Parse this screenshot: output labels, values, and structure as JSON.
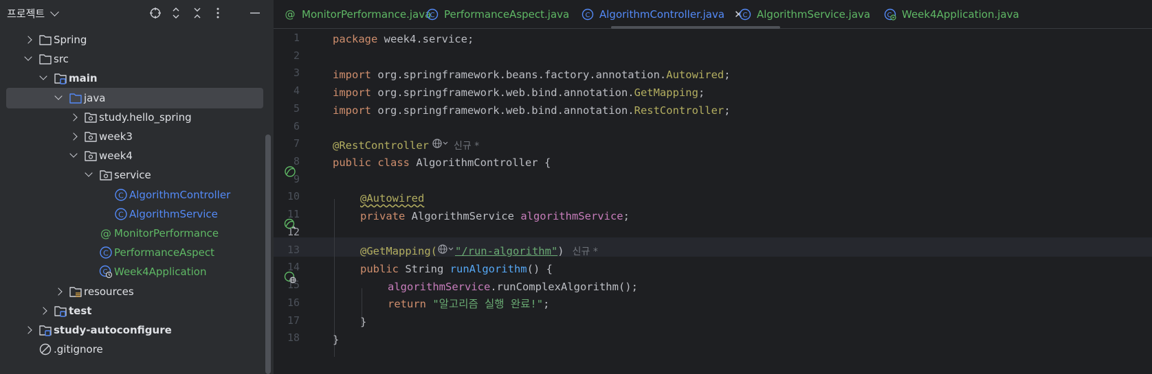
{
  "project_panel": {
    "title": "프로젝트",
    "tree": [
      {
        "label": "Spring",
        "icon": "folder-icon",
        "arrow": "right",
        "level": 1,
        "style": "normal"
      },
      {
        "label": "src",
        "icon": "folder-icon",
        "arrow": "down",
        "level": 1,
        "style": "normal"
      },
      {
        "label": "main",
        "icon": "module-folder-icon",
        "arrow": "down",
        "level": 2,
        "style": "bold"
      },
      {
        "label": "java",
        "icon": "source-folder-icon",
        "arrow": "down",
        "level": 3,
        "style": "normal",
        "selected": true
      },
      {
        "label": "study.hello_spring",
        "icon": "package-icon",
        "arrow": "right",
        "level": 4,
        "style": "normal"
      },
      {
        "label": "week3",
        "icon": "package-icon",
        "arrow": "right",
        "level": 4,
        "style": "normal"
      },
      {
        "label": "week4",
        "icon": "package-icon",
        "arrow": "down",
        "level": 4,
        "style": "normal"
      },
      {
        "label": "service",
        "icon": "package-icon",
        "arrow": "down",
        "level": 5,
        "style": "normal"
      },
      {
        "label": "AlgorithmController",
        "icon": "class-icon",
        "arrow": "none",
        "level": 6,
        "style": "blue"
      },
      {
        "label": "AlgorithmService",
        "icon": "class-icon",
        "arrow": "none",
        "level": 6,
        "style": "blue"
      },
      {
        "label": "MonitorPerformance",
        "icon": "annotation-icon",
        "arrow": "none",
        "level": 5,
        "style": "green"
      },
      {
        "label": "PerformanceAspect",
        "icon": "class-icon",
        "arrow": "none",
        "level": 5,
        "style": "green"
      },
      {
        "label": "Week4Application",
        "icon": "spring-class-icon",
        "arrow": "none",
        "level": 5,
        "style": "green"
      },
      {
        "label": "resources",
        "icon": "resources-folder-icon",
        "arrow": "right",
        "level": 3,
        "style": "normal"
      },
      {
        "label": "test",
        "icon": "module-folder-icon",
        "arrow": "right",
        "level": 2,
        "style": "bold"
      },
      {
        "label": "study-autoconfigure",
        "icon": "module-folder-icon",
        "arrow": "right",
        "level": 1,
        "style": "bold"
      },
      {
        "label": ".gitignore",
        "icon": "ignore-icon",
        "arrow": "none",
        "level": 1,
        "style": "normal"
      }
    ]
  },
  "tabs": [
    {
      "label": "MonitorPerformance.java",
      "icon": "annotation-icon"
    },
    {
      "label": "PerformanceAspect.java",
      "icon": "class-icon"
    },
    {
      "label": "AlgorithmController.java",
      "icon": "class-icon",
      "active": true
    },
    {
      "label": "AlgorithmService.java",
      "icon": "class-icon"
    },
    {
      "label": "Week4Application.java",
      "icon": "spring-class-icon"
    }
  ],
  "editor": {
    "current_line": "12",
    "line_numbers": [
      "1",
      "2",
      "3",
      "4",
      "5",
      "6",
      "7",
      "8",
      "9",
      "10",
      "11",
      "12",
      "13",
      "14",
      "15",
      "16",
      "17",
      "18"
    ],
    "code": {
      "l1_kw": "package",
      "l1_rest": " week4.service;",
      "l3_kw": "import",
      "l3_pkg": " org.springframework.beans.factory.annotation.",
      "l3_cls": "Autowired",
      "l3_end": ";",
      "l4_kw": "import",
      "l4_pkg": " org.springframework.web.bind.annotation.",
      "l4_cls": "GetMapping",
      "l4_end": ";",
      "l5_kw": "import",
      "l5_pkg": " org.springframework.web.bind.annotation.",
      "l5_cls": "RestController",
      "l5_end": ";",
      "l7_ann": "@RestController",
      "l7_hint": "신규 *",
      "l8_kw": "public class",
      "l8_rest": " AlgorithmController {",
      "l10_ann": "@Autowired",
      "l11_kw": "private",
      "l11_type": " AlgorithmService ",
      "l11_field": "algorithmService",
      "l11_end": ";",
      "l13_ann": "@GetMapping(",
      "l13_str": "\"/run-algorithm\"",
      "l13_end": ")",
      "l13_hint": "신규 *",
      "l14_kw": "public",
      "l14_type": " String ",
      "l14_fn": "runAlgorithm",
      "l14_end": "() {",
      "l15_field": "algorithmService",
      "l15_rest": ".runComplexAlgorithm();",
      "l16_kw": "return",
      "l16_str": "\"알고리즘 실행 완료!\"",
      "l16_end": ";",
      "l17": "}",
      "l18": "}"
    }
  }
}
